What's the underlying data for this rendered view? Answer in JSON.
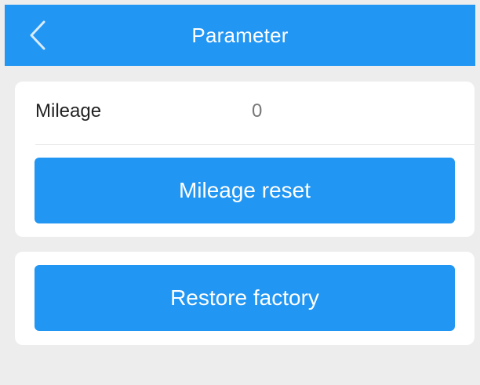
{
  "header": {
    "title": "Parameter",
    "back_icon": "chevron-left-icon"
  },
  "mileage": {
    "label": "Mileage",
    "value": "0",
    "reset_button_label": "Mileage reset"
  },
  "factory": {
    "restore_button_label": "Restore factory"
  },
  "colors": {
    "accent": "#2196f3",
    "background": "#ededed",
    "card": "#ffffff"
  }
}
